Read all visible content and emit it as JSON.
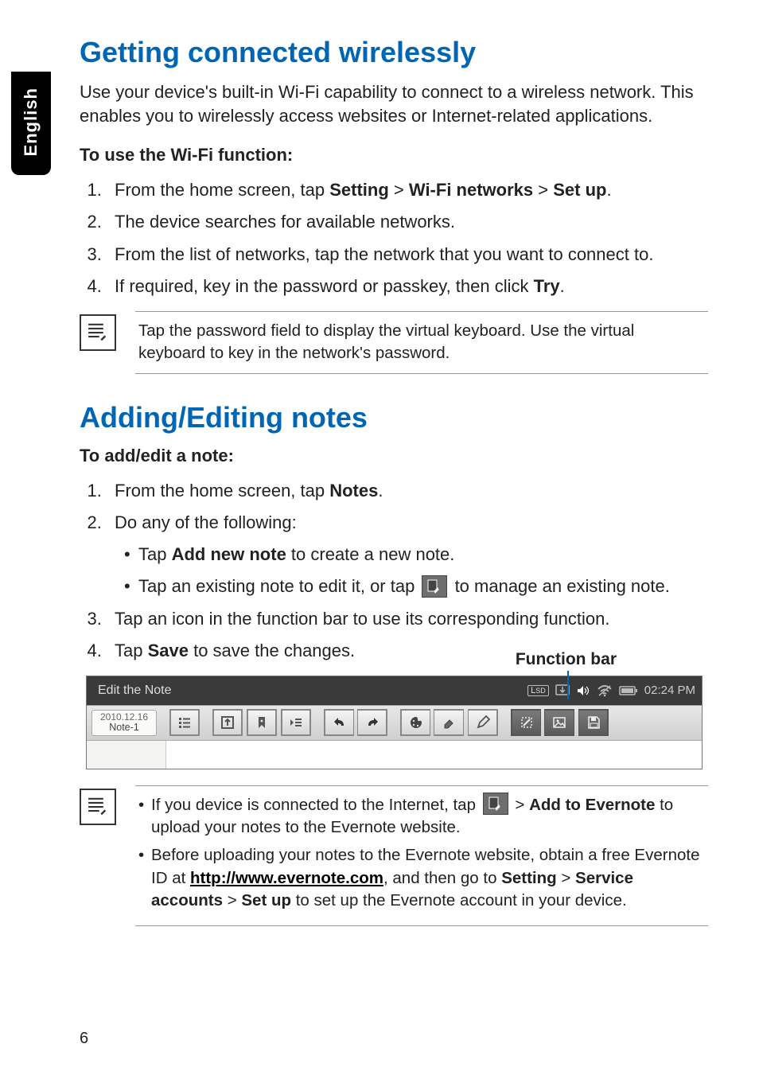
{
  "side_tab": {
    "label": "English"
  },
  "section1": {
    "heading": "Getting connected wirelessly",
    "intro": "Use your device's built-in Wi-Fi capability to connect to a wireless network. This enables you to wirelessly access websites or Internet-related applications.",
    "subhead": "To use the Wi-Fi function:",
    "steps": {
      "s1_a": "From the home screen, tap ",
      "s1_b": "Setting",
      "s1_c": " > ",
      "s1_d": "Wi-Fi networks",
      "s1_e": " > ",
      "s1_f": "Set up",
      "s1_g": ".",
      "s2": "The device searches for available networks.",
      "s3": "From the list of networks, tap the network that you want to connect to.",
      "s4_a": "If required, key in the password or passkey, then click ",
      "s4_b": "Try",
      "s4_c": "."
    },
    "note": "Tap the password field to display the virtual keyboard. Use the virtual keyboard to key in the network's password."
  },
  "section2": {
    "heading": "Adding/Editing notes",
    "subhead": "To add/edit a note:",
    "steps": {
      "s1_a": "From the home screen, tap ",
      "s1_b": "Notes",
      "s1_c": ".",
      "s2": "Do any of the following:",
      "b1_a": "Tap ",
      "b1_b": "Add new note",
      "b1_c": " to create a new note.",
      "b2_a": "Tap an existing note to edit it, or tap ",
      "b2_b": " to manage an existing note.",
      "s3": "Tap an icon in the function bar to use its corresponding function.",
      "s4_a": "Tap ",
      "s4_b": "Save",
      "s4_c": " to save the changes."
    },
    "fnbar_label": "Function bar",
    "device": {
      "title": "Edit the Note",
      "tag_date": "2010.12.16",
      "tag_name": "Note-1",
      "status_sd": "SD",
      "status_time": "02:24 PM"
    },
    "note2": {
      "li1_a": "If you device is connected to the Internet, tap ",
      "li1_b": " > ",
      "li1_c": "Add to Evernote",
      "li1_d": " to upload your notes to the Evernote website.",
      "li2_a": "Before uploading your notes to the Evernote website, obtain a free Evernote ID at ",
      "li2_link": "http://www.evernote.com",
      "li2_b": ", and then go to ",
      "li2_c": "Setting",
      "li2_d": " > ",
      "li2_e": "Service accounts",
      "li2_f": " > ",
      "li2_g": "Set up",
      "li2_h": " to set up the Evernote account in your device."
    }
  },
  "page_number": "6"
}
